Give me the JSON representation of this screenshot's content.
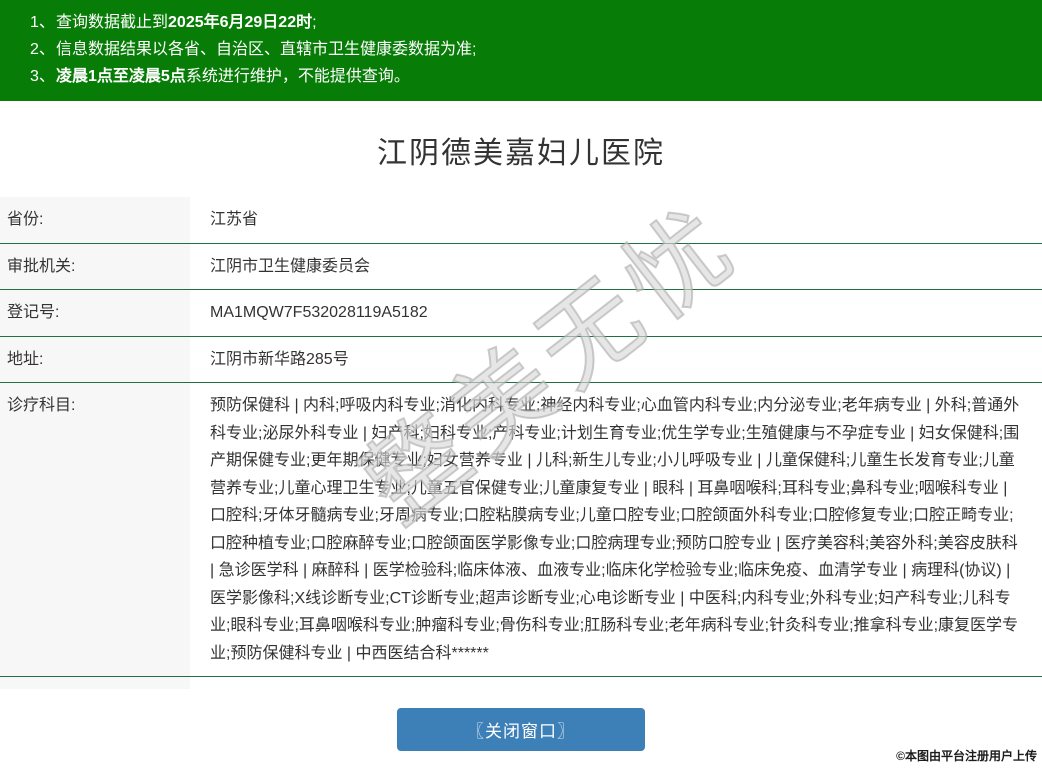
{
  "notice": {
    "items": [
      {
        "num": "1、",
        "pre": "查询数据截止到",
        "bold": "2025年6月29日22时",
        "post": ";"
      },
      {
        "num": "2、",
        "pre": "信息数据结果以各省、自治区、直辖市卫生健康委数据为准;",
        "bold": "",
        "post": ""
      },
      {
        "num": "3、",
        "pre": "",
        "bold": "凌晨1点至凌晨5点",
        "post": "系统进行维护，不能提供查询。"
      }
    ]
  },
  "hospital": {
    "title": "江阴德美嘉妇儿医院"
  },
  "table": {
    "rows": [
      {
        "label": "省份:",
        "value": "江苏省"
      },
      {
        "label": "审批机关:",
        "value": "江阴市卫生健康委员会"
      },
      {
        "label": "登记号:",
        "value": "MA1MQW7F532028119A5182"
      },
      {
        "label": "地址:",
        "value": "江阴市新华路285号"
      },
      {
        "label": "诊疗科目:",
        "value": "预防保健科 | 内科;呼吸内科专业;消化内科专业;神经内科专业;心血管内科专业;内分泌专业;老年病专业 | 外科;普通外科专业;泌尿外科专业 | 妇产科;妇科专业;产科专业;计划生育专业;优生学专业;生殖健康与不孕症专业 | 妇女保健科;围产期保健专业;更年期保健专业;妇女营养专业 | 儿科;新生儿专业;小儿呼吸专业 | 儿童保健科;儿童生长发育专业;儿童营养专业;儿童心理卫生专业;儿童五官保健专业;儿童康复专业 | 眼科 | 耳鼻咽喉科;耳科专业;鼻科专业;咽喉科专业 | 口腔科;牙体牙髓病专业;牙周病专业;口腔粘膜病专业;儿童口腔专业;口腔颌面外科专业;口腔修复专业;口腔正畸专业;口腔种植专业;口腔麻醉专业;口腔颌面医学影像专业;口腔病理专业;预防口腔专业 | 医疗美容科;美容外科;美容皮肤科 | 急诊医学科 | 麻醉科 | 医学检验科;临床体液、血液专业;临床化学检验专业;临床免疫、血清学专业 | 病理科(协议) | 医学影像科;X线诊断专业;CT诊断专业;超声诊断专业;心电诊断专业 | 中医科;内科专业;外科专业;妇产科专业;儿科专业;眼科专业;耳鼻咽喉科专业;肿瘤科专业;骨伤科专业;肛肠科专业;老年病科专业;针灸科专业;推拿科专业;康复医学专业;预防保健科专业 | 中西医结合科******"
      }
    ]
  },
  "watermark": {
    "text": "整美无忧"
  },
  "footer": {
    "close_button": "〖关闭窗口〗",
    "credit": "©本图由平台注册用户上传"
  },
  "colors": {
    "header_green": "#077d07",
    "row_divider": "#1f7044",
    "button_blue": "#3d80b8",
    "label_bg": "#f7f7f7"
  }
}
